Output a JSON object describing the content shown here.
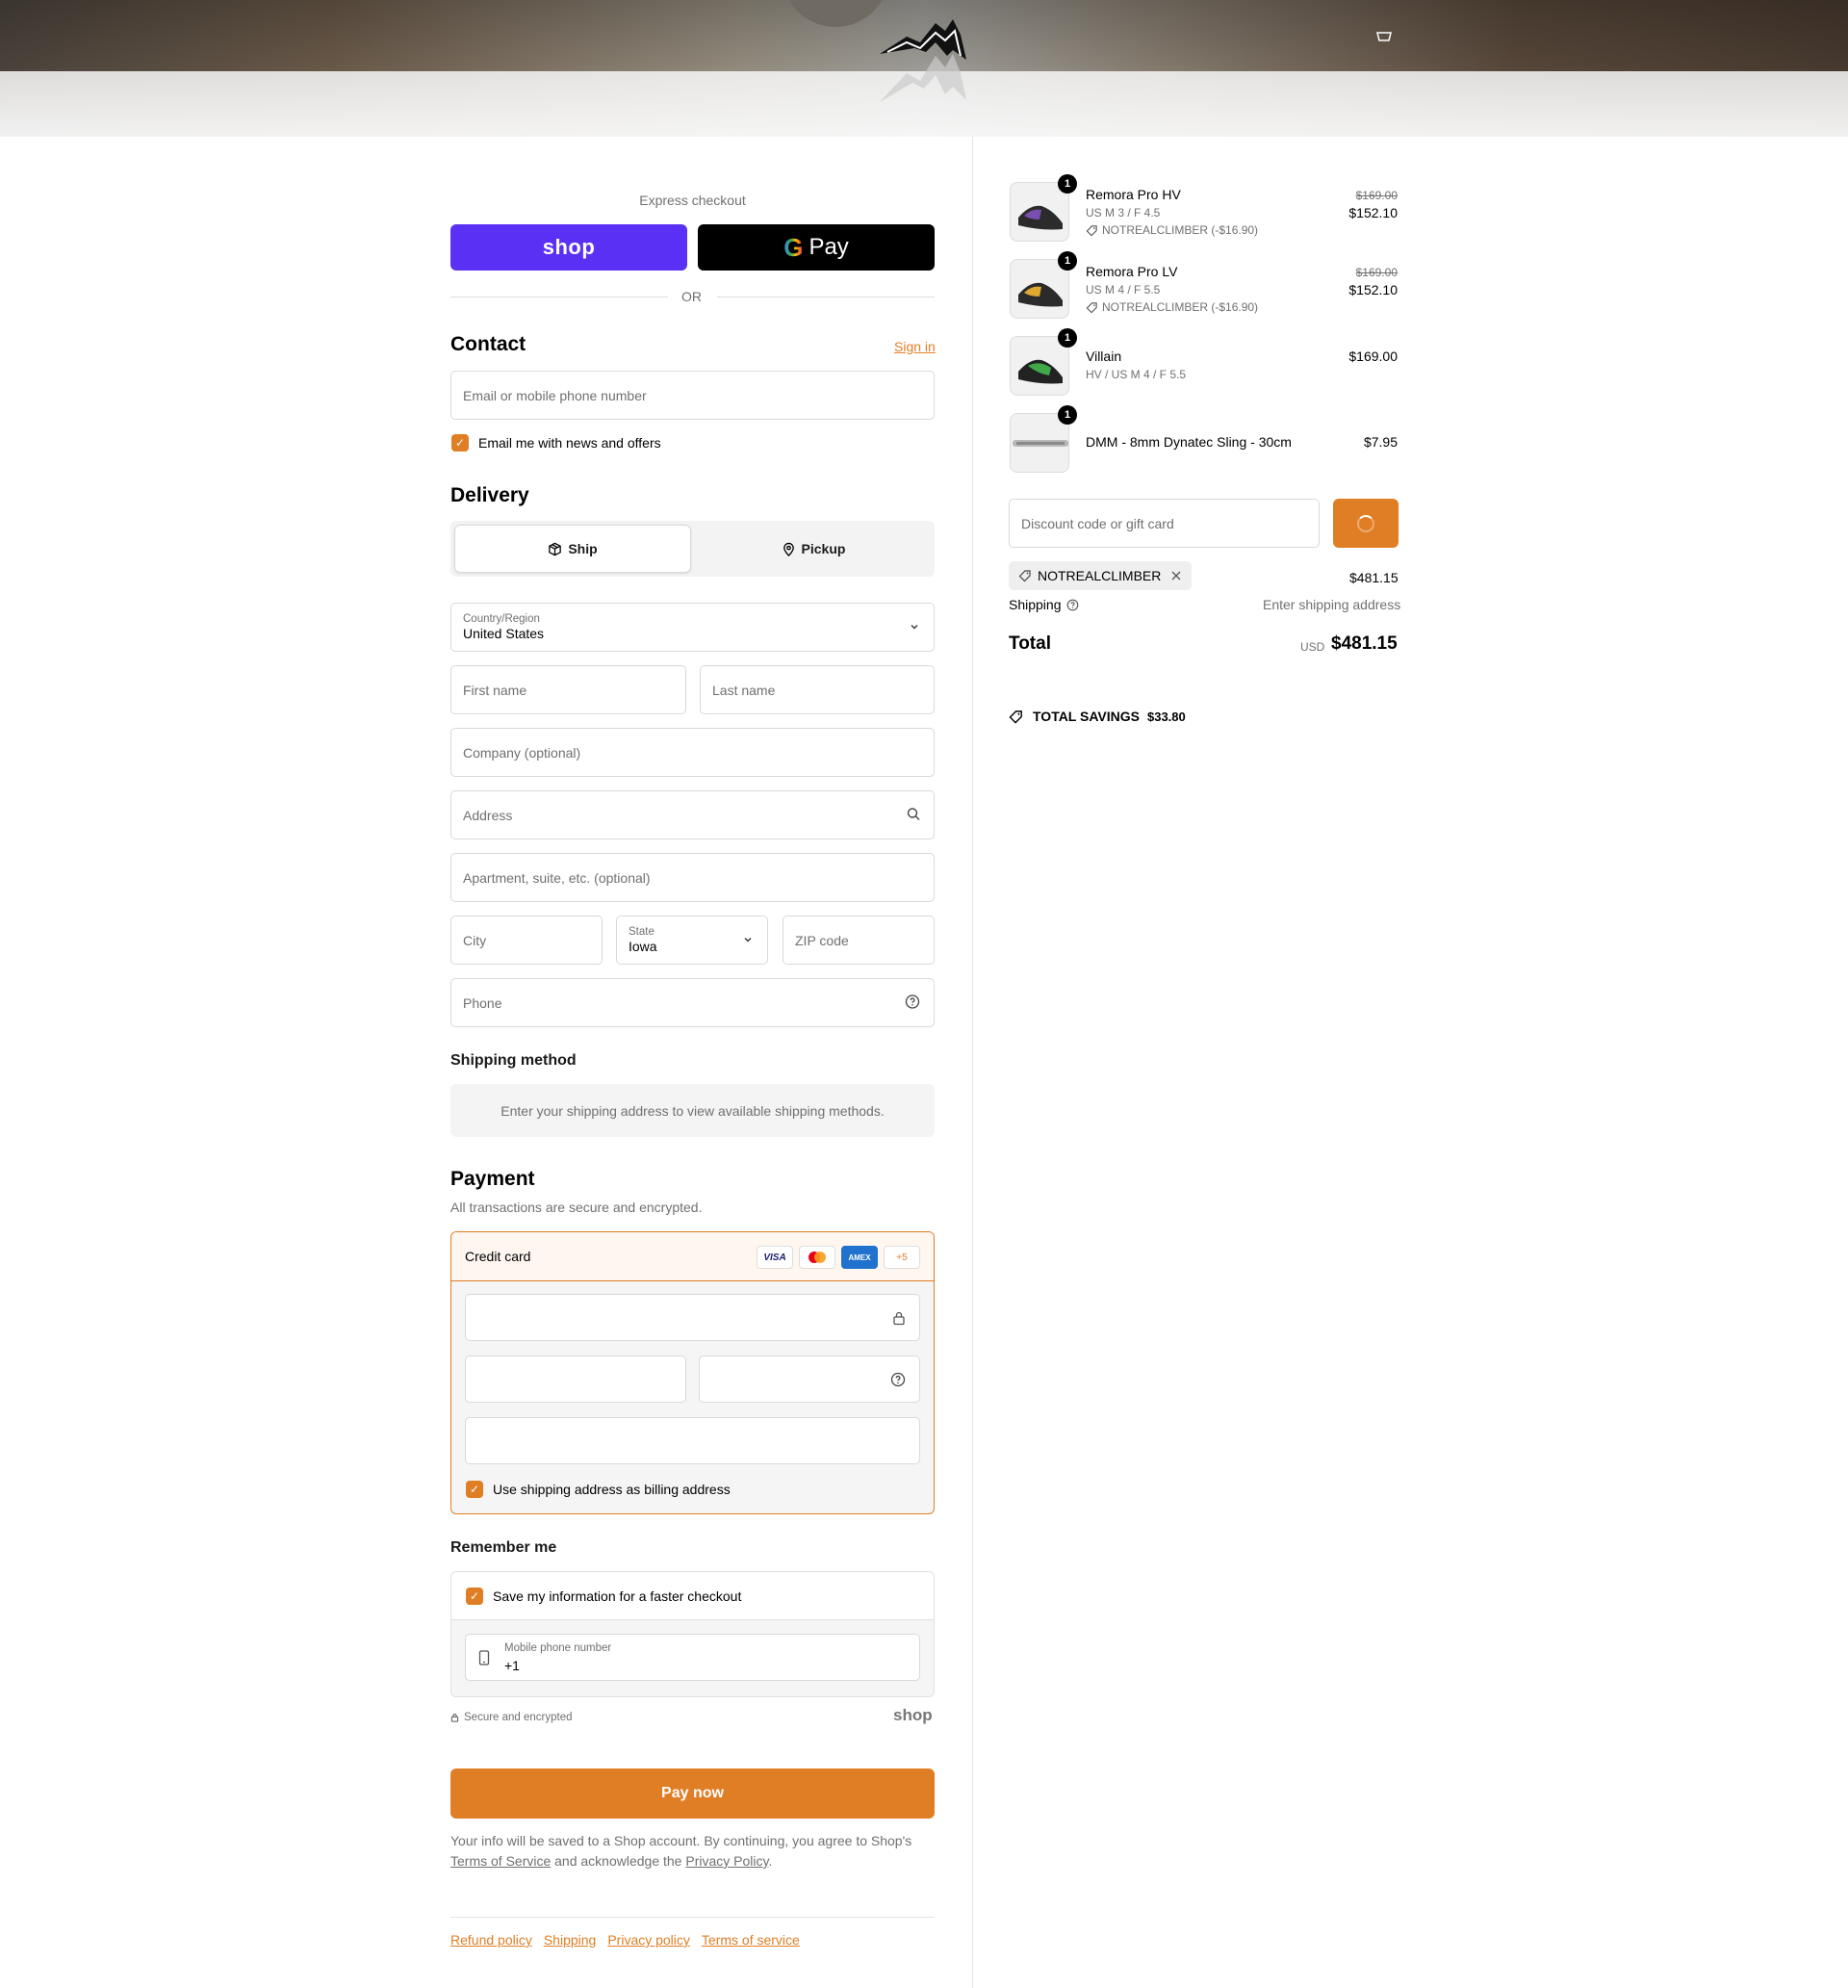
{
  "express": {
    "title": "Express checkout",
    "shop_label": "shop",
    "gpay_g": "G",
    "gpay_label": "Pay",
    "or_label": "OR"
  },
  "contact": {
    "title": "Contact",
    "signin": "Sign in",
    "email_placeholder": "Email or mobile phone number",
    "newsletter_label": "Email me with news and offers",
    "newsletter_checked": true
  },
  "delivery": {
    "title": "Delivery",
    "ship_label": "Ship",
    "pickup_label": "Pickup",
    "country_label": "Country/Region",
    "country_value": "United States",
    "first_name": "First name",
    "last_name": "Last name",
    "company": "Company (optional)",
    "address": "Address",
    "apartment": "Apartment, suite, etc. (optional)",
    "city": "City",
    "state_label": "State",
    "state_value": "Iowa",
    "zip": "ZIP code",
    "phone": "Phone"
  },
  "shipping_method": {
    "title": "Shipping method",
    "note": "Enter your shipping address to view available shipping methods."
  },
  "payment": {
    "title": "Payment",
    "subtitle": "All transactions are secure and encrypted.",
    "method_label": "Credit card",
    "cards": [
      "VISA",
      "MC",
      "AMEX",
      "+5"
    ],
    "billing_label": "Use shipping address as billing address",
    "billing_checked": true
  },
  "remember": {
    "title": "Remember me",
    "save_label": "Save my information for a faster checkout",
    "save_checked": true,
    "mobile_label": "Mobile phone number",
    "mobile_value": "+1",
    "secure_label": "Secure and encrypted",
    "shop_label": "shop"
  },
  "pay_now": "Pay now",
  "terms": {
    "text1": "Your info will be saved to a Shop account. By continuing, you agree to Shop's",
    "tos": "Terms of Service",
    "text2": "and acknowledge the",
    "privacy": "Privacy Policy",
    "end": "."
  },
  "footer": [
    "Refund policy",
    "Shipping",
    "Privacy policy",
    "Terms of service"
  ],
  "cart": {
    "items": [
      {
        "qty": "1",
        "name": "Remora Pro HV",
        "variant": "US M 3 / F 4.5",
        "discount": "NOTREALCLIMBER (-$16.90)",
        "old_price": "$169.00",
        "price": "$152.10",
        "colors": [
          "#7a4fb0",
          "#2b2b2b"
        ]
      },
      {
        "qty": "1",
        "name": "Remora Pro LV",
        "variant": "US M 4 / F 5.5",
        "discount": "NOTREALCLIMBER (-$16.90)",
        "old_price": "$169.00",
        "price": "$152.10",
        "colors": [
          "#e0a82e",
          "#2b2b2b"
        ]
      },
      {
        "qty": "1",
        "name": "Villain",
        "variant": "HV / US M 4 / F 5.5",
        "price": "$169.00",
        "colors": [
          "#3fa94a",
          "#222222"
        ]
      },
      {
        "qty": "1",
        "name": "DMM - 8mm Dynatec Sling - 30cm",
        "price": "$7.95",
        "colors": [
          "#b8b8b8",
          "#8a8a8a"
        ]
      }
    ],
    "discount_placeholder": "Discount code or gift card",
    "applied_code": "NOTREALCLIMBER",
    "subtotal": "$481.15",
    "shipping_label": "Shipping",
    "shipping_value": "Enter shipping address",
    "total_label": "Total",
    "currency": "USD",
    "total": "$481.15",
    "savings_label": "TOTAL SAVINGS",
    "savings_value": "$33.80"
  },
  "colors": {
    "accent": "#e07e25",
    "shop": "#5a31f4"
  }
}
